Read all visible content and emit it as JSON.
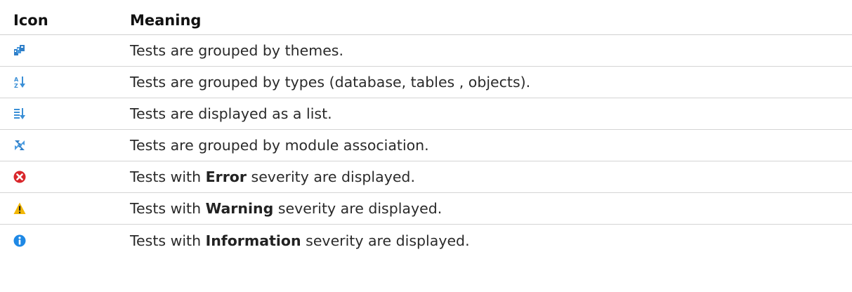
{
  "header": {
    "icon_label": "Icon",
    "meaning_label": "Meaning"
  },
  "rows": [
    {
      "icon": "group-by-themes-icon",
      "pre": "Tests are grouped by themes.",
      "bold": "",
      "post": ""
    },
    {
      "icon": "sort-az-icon",
      "pre": "Tests are grouped by types (database, tables , objects).",
      "bold": "",
      "post": ""
    },
    {
      "icon": "list-sort-icon",
      "pre": "Tests are displayed as a list.",
      "bold": "",
      "post": ""
    },
    {
      "icon": "module-association-icon",
      "pre": "Tests are grouped by module association.",
      "bold": "",
      "post": ""
    },
    {
      "icon": "error-icon",
      "pre": "Tests with ",
      "bold": "Error",
      "post": " severity are displayed."
    },
    {
      "icon": "warning-icon",
      "pre": "Tests with ",
      "bold": "Warning",
      "post": " severity are displayed."
    },
    {
      "icon": "information-icon",
      "pre": "Tests with ",
      "bold": "Information",
      "post": " severity are displayed."
    }
  ],
  "colors": {
    "icon_blue": "#3a8fd6",
    "error_red": "#d9262b",
    "warning_yellow": "#f2b705",
    "info_blue": "#1e88e5"
  }
}
